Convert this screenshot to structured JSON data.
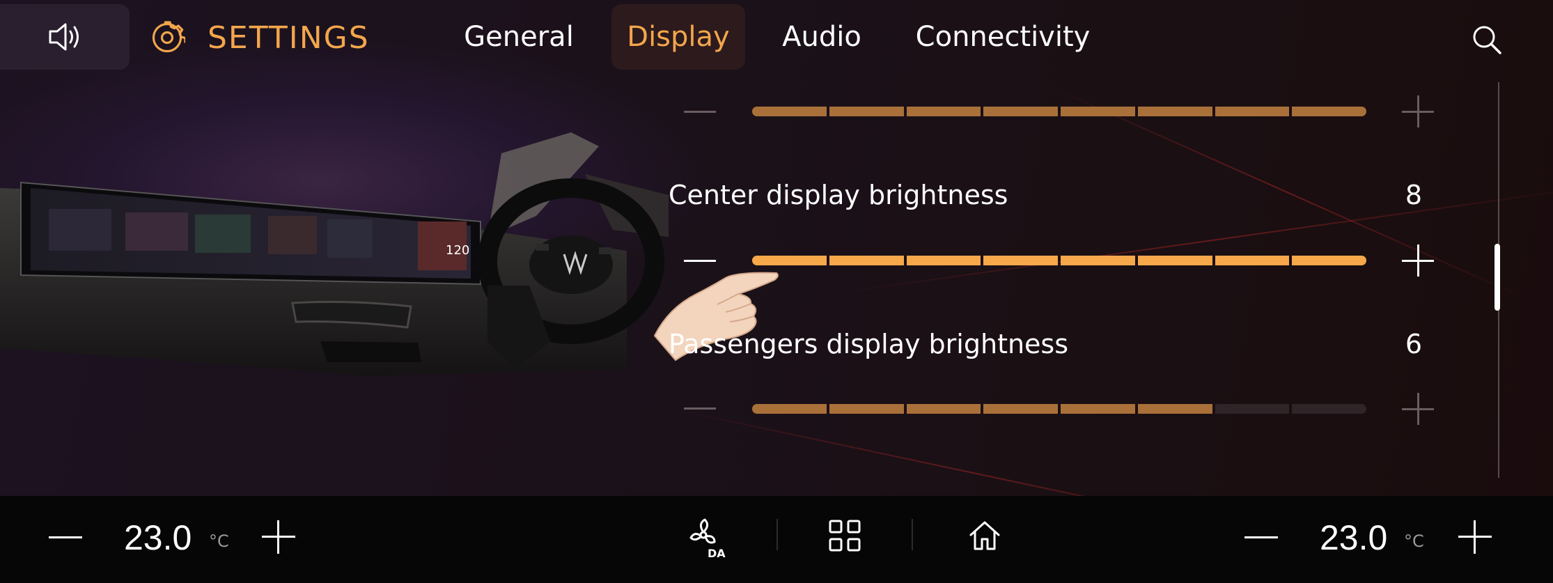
{
  "header": {
    "title": "SETTINGS",
    "tabs": [
      {
        "label": "General",
        "active": false
      },
      {
        "label": "Display",
        "active": true
      },
      {
        "label": "Audio",
        "active": false
      },
      {
        "label": "Connectivity",
        "active": false
      }
    ],
    "icons": [
      "speaker-icon",
      "gear-icon",
      "search-icon"
    ]
  },
  "settings": [
    {
      "title": "",
      "value": "",
      "level": 8,
      "max": 8,
      "partially_hidden": true
    },
    {
      "title": "Center display brightness",
      "value": "8",
      "level": 8,
      "max": 8
    },
    {
      "title": "Passengers display brightness",
      "value": "6",
      "level": 6,
      "max": 8
    }
  ],
  "climate": {
    "left_temp": "23.0",
    "right_temp": "23.0",
    "unit": "°C"
  },
  "bottom_icons": [
    "fan-auto-icon",
    "apps-grid-icon",
    "home-icon"
  ],
  "colors": {
    "accent": "#f3a64c",
    "slider_active": "#f7a84a",
    "slider_dim": "#a9703a",
    "slider_empty": "#2f2428"
  }
}
